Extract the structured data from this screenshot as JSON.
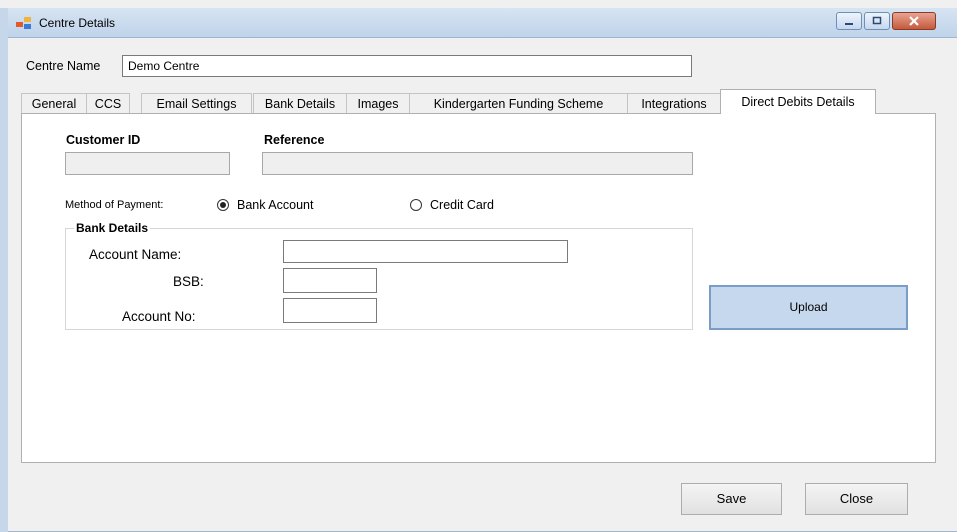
{
  "window": {
    "title": "Centre Details"
  },
  "centre": {
    "label": "Centre Name",
    "value": "Demo Centre"
  },
  "tabs": [
    {
      "label": "General"
    },
    {
      "label": "CCS"
    },
    {
      "label": "Email Settings"
    },
    {
      "label": "Bank Details"
    },
    {
      "label": "Images"
    },
    {
      "label": "Kindergarten Funding Scheme"
    },
    {
      "label": "Integrations"
    },
    {
      "label": "Direct Debits Details"
    }
  ],
  "direct_debits": {
    "customer_id_label": "Customer ID",
    "customer_id_value": "",
    "reference_label": "Reference",
    "reference_value": "",
    "method_label": "Method of Payment:",
    "method_options": [
      {
        "label": "Bank Account",
        "selected": true
      },
      {
        "label": "Credit Card",
        "selected": false
      }
    ],
    "bank_details": {
      "legend": "Bank Details",
      "account_name_label": "Account Name:",
      "account_name_value": "",
      "bsb_label": "BSB:",
      "bsb_value": "",
      "account_no_label": "Account No:",
      "account_no_value": ""
    },
    "upload_label": "Upload"
  },
  "footer": {
    "save_label": "Save",
    "close_label": "Close"
  },
  "colors": {
    "titlebar": "#c9dbef",
    "upload_fill": "#c5d8ee",
    "close_button": "#c45a3c"
  }
}
